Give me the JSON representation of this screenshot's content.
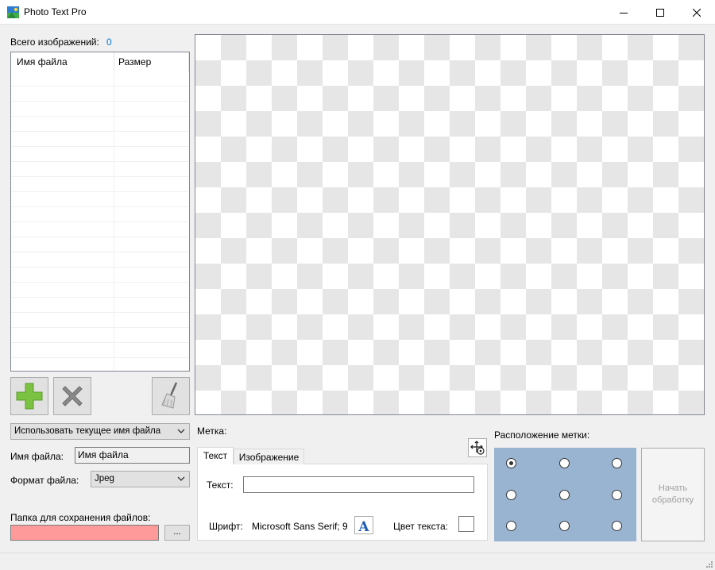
{
  "window": {
    "title": "Photo Text Pro",
    "controls": [
      "minimize-icon",
      "maximize-icon",
      "close-icon"
    ]
  },
  "files": {
    "count_label": "Всего изображений:",
    "count_value": "0",
    "columns": [
      "Имя файла",
      "Размер"
    ],
    "rows": []
  },
  "toolbar": {
    "add_icon": "plus-icon",
    "remove_icon": "x-icon",
    "clear_icon": "broom-icon"
  },
  "output": {
    "name_mode": "Использовать текущее имя файла",
    "filename_label": "Имя файла:",
    "filename_value": "Имя файла",
    "format_label": "Формат файла:",
    "format_value": "Jpeg",
    "folder_label": "Папка для сохранения файлов:",
    "folder_value": "",
    "browse_label": "...",
    "folder_color": "#ff9a9a"
  },
  "mark": {
    "label": "Метка:",
    "tabs": [
      "Текст",
      "Изображение"
    ],
    "active_tab": "Текст",
    "text_label": "Текст:",
    "text_value": "",
    "font_label": "Шрифт:",
    "font_value": "Microsoft Sans Serif; 9",
    "color_label": "Цвет текста:",
    "text_color": "#ffffff"
  },
  "position": {
    "label": "Расположение метки:",
    "selected": "top-left",
    "grid_color": "#99b4d1"
  },
  "start_button": "Начать обработку"
}
